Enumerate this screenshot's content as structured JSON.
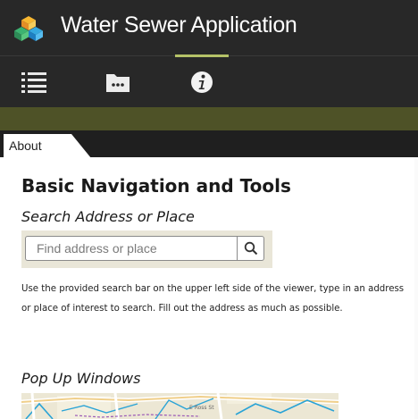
{
  "header": {
    "title": "Water Sewer Application",
    "logo_icon": "colored-cubes-logo-icon",
    "background": "#282828"
  },
  "toolbar": {
    "buttons": [
      {
        "icon": "list-icon",
        "active": false
      },
      {
        "icon": "folder-icon",
        "active": false
      },
      {
        "icon": "info-icon",
        "active": true
      }
    ],
    "active_indicator_color": "#b5c267",
    "banner_color": "#4e5227"
  },
  "tabs": [
    {
      "label": "About",
      "active": true
    }
  ],
  "content": {
    "heading": "Basic Navigation and Tools",
    "search_heading": "Search Address or Place",
    "search": {
      "placeholder": "Find address or place",
      "button_icon": "search-icon"
    },
    "search_description": "Use the provided search bar on the upper left side of the viewer, type in an address or place of interest to search. Fill out the address as much as possible.",
    "popup_heading": "Pop Up Windows",
    "map_label": "E Ross St"
  }
}
